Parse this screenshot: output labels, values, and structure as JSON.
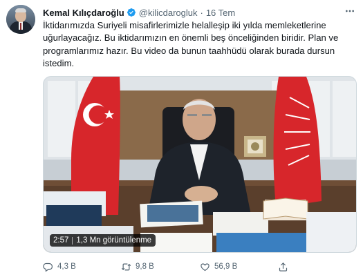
{
  "tweet": {
    "author_name": "Kemal Kılıçdaroğlu",
    "handle": "@kilicdarogluk",
    "separator": "·",
    "time": "16 Tem",
    "text_lines": [
      "İktidarımızda Suriyeli misafirlerimizle helalleşip iki yılda memleketlerine",
      "uğurlayacağız. Bu iktidarımızın en önemli beş önceliğinden biridir. Plan ve",
      "programlarımız hazır. Bu video da bunun taahhüdü olarak burada dursun",
      "istedim."
    ]
  },
  "video": {
    "duration": "2:57",
    "views": "1,3 Mn görüntülenme"
  },
  "actions": {
    "replies": "4,3 B",
    "retweets": "9,8 B",
    "likes": "56,9 B"
  },
  "colors": {
    "text": "#0f1419",
    "secondary": "#536471",
    "verified": "#1d9bf0",
    "flag_red": "#d7262b"
  },
  "icons": [
    "verified-badge-icon",
    "more-icon",
    "reply-icon",
    "retweet-icon",
    "like-icon",
    "share-icon"
  ]
}
